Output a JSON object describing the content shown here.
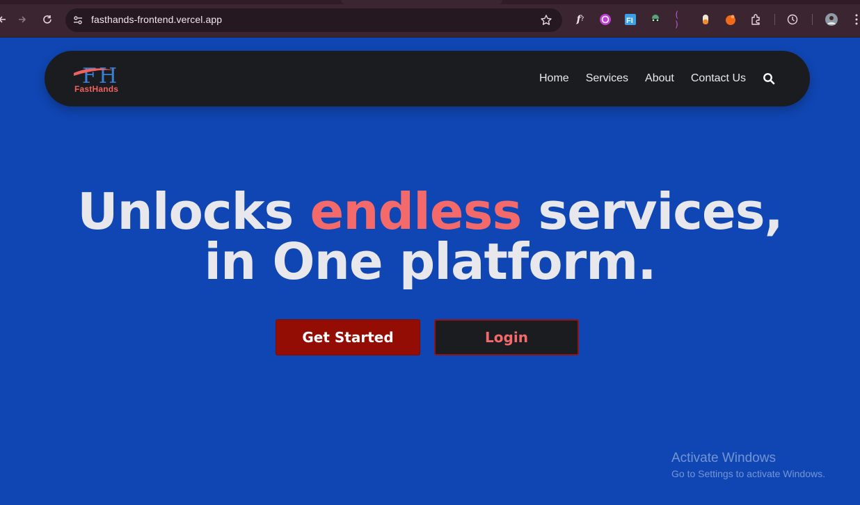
{
  "browser": {
    "url": "fasthands-frontend.vercel.app",
    "icons": [
      "back-icon",
      "forward-icon",
      "reload-icon",
      "site-settings-icon",
      "bookmark-star-icon",
      "extensions-icon",
      "history-icon",
      "profile-avatar-icon",
      "menu-icon"
    ]
  },
  "navbar": {
    "logo_text": "FastHands",
    "links": [
      "Home",
      "Services",
      "About",
      "Contact Us"
    ],
    "search_icon": "search-icon"
  },
  "hero": {
    "line1_before": "Unlocks ",
    "line1_accent": "endless",
    "line1_after": " services,",
    "line2": "in One platform.",
    "primary_button": "Get Started",
    "secondary_button": "Login"
  },
  "watermark": {
    "title": "Activate Windows",
    "subtitle": "Go to Settings to activate Windows."
  },
  "colors": {
    "page_background": "#1046b3",
    "navbar_background": "#1b1c1f",
    "accent": "#f46a6a",
    "primary_button": "#930d05",
    "browser_chrome": "#3b2531"
  }
}
